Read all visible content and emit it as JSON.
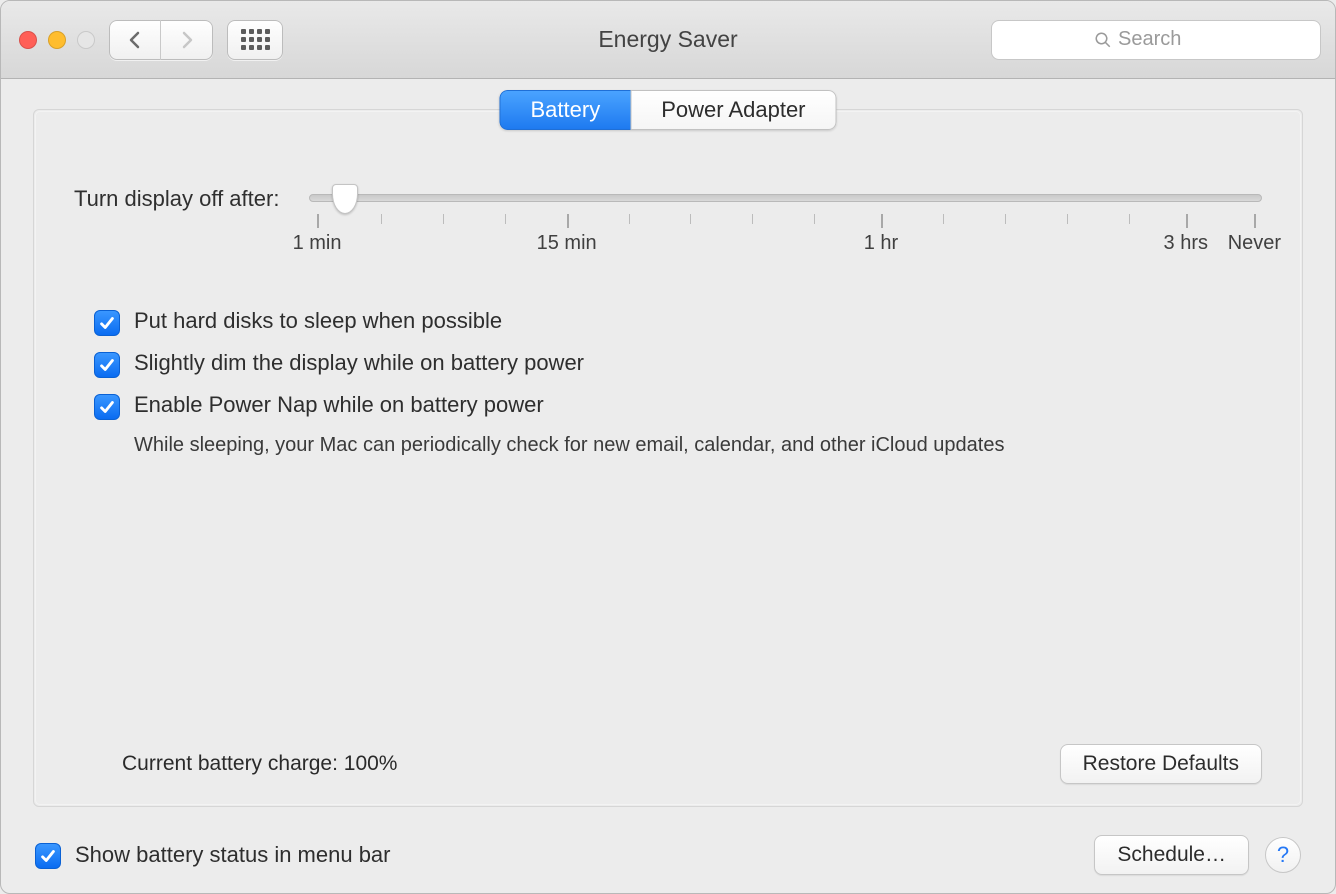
{
  "window": {
    "title": "Energy Saver"
  },
  "search": {
    "placeholder": "Search"
  },
  "tabs": {
    "battery": "Battery",
    "power_adapter": "Power Adapter",
    "active": "battery"
  },
  "slider": {
    "label": "Turn display off after:",
    "value_percent": 3.7,
    "ticks": {
      "min": "1 min",
      "fifteen": "15 min",
      "hour": "1 hr",
      "three_hours": "3 hrs",
      "never": "Never"
    }
  },
  "options": {
    "hard_disks": {
      "label": "Put hard disks to sleep when possible",
      "checked": true
    },
    "dim_display": {
      "label": "Slightly dim the display while on battery power",
      "checked": true
    },
    "power_nap": {
      "label": "Enable Power Nap while on battery power",
      "sub": "While sleeping, your Mac can periodically check for new email, calendar, and other iCloud updates",
      "checked": true
    }
  },
  "status": {
    "current_charge": "Current battery charge: 100%"
  },
  "buttons": {
    "restore": "Restore Defaults",
    "schedule": "Schedule…",
    "help": "?"
  },
  "footer": {
    "show_menu_bar": {
      "label": "Show battery status in menu bar",
      "checked": true
    }
  }
}
